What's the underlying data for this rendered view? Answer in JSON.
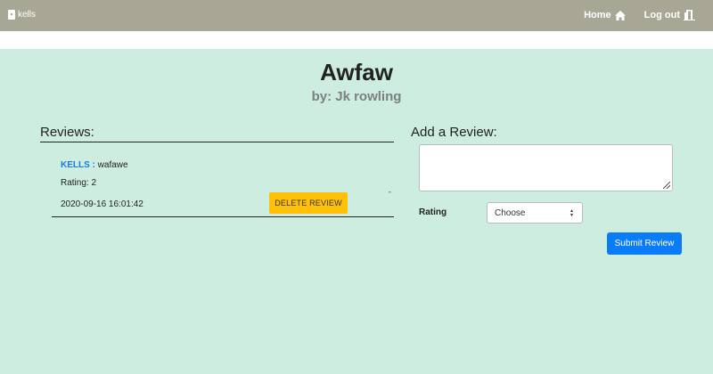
{
  "nav": {
    "brand_label": "kells",
    "home_label": "Home",
    "logout_label": "Log out"
  },
  "book": {
    "title": "Awfaw",
    "author": "by: Jk rowling"
  },
  "reviews": {
    "heading": "Reviews:",
    "items": [
      {
        "author": "KELLS",
        "separator": " : ",
        "text": "wafawe",
        "rating": "Rating: 2",
        "date": "2020-09-16 16:01:42",
        "delete_label": "DELETE REVIEW",
        "quote_mark": "”"
      }
    ]
  },
  "add_review": {
    "heading": "Add a Review:",
    "textarea_value": "",
    "rating_label": "Rating",
    "rating_selected": "Choose",
    "submit_label": "Submit Review"
  },
  "colors": {
    "navbar": "#a8a796",
    "background": "#cdede0",
    "author_link": "#1a7bd8",
    "delete_button": "#ffc107",
    "submit_button": "#0b7cf7"
  },
  "icons": {
    "brand": "book-icon",
    "home": "home-icon",
    "logout": "door-exit-icon",
    "select": "select-arrows-icon",
    "textarea": "resize-grip-icon"
  }
}
